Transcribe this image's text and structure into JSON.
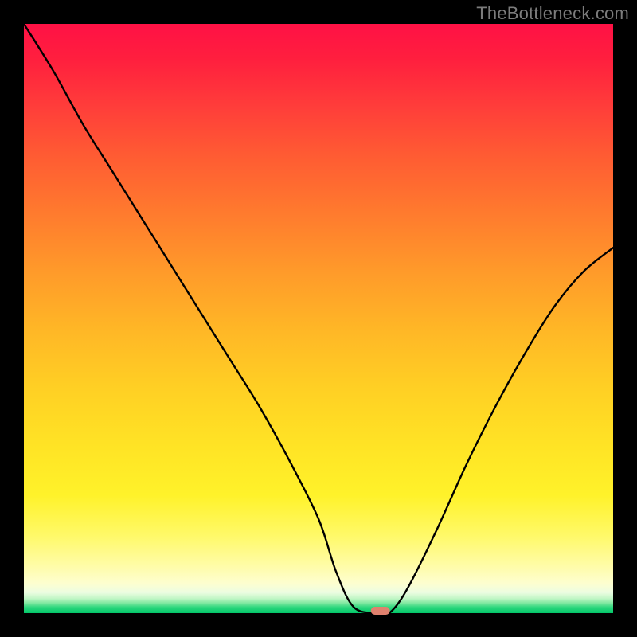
{
  "attribution": "TheBottleneck.com",
  "chart_data": {
    "type": "line",
    "title": "",
    "xlabel": "",
    "ylabel": "",
    "xlim": [
      0,
      100
    ],
    "ylim": [
      0,
      100
    ],
    "legend": false,
    "grid": false,
    "series": [
      {
        "name": "bottleneck-curve",
        "x": [
          0,
          5,
          10,
          15,
          20,
          25,
          30,
          35,
          40,
          45,
          50,
          53,
          56,
          60,
          62,
          65,
          70,
          75,
          80,
          85,
          90,
          95,
          100
        ],
        "values": [
          100,
          92,
          83,
          75,
          67,
          59,
          51,
          43,
          35,
          26,
          16,
          7,
          1,
          0,
          0,
          4,
          14,
          25,
          35,
          44,
          52,
          58,
          62
        ]
      }
    ],
    "annotations": [
      {
        "name": "optimum-marker",
        "x": 60.5,
        "y": 0.4,
        "shape": "pill",
        "color": "#e0816e"
      }
    ],
    "background_gradient": {
      "direction": "vertical",
      "stops": [
        {
          "pos": 0,
          "color": "#ff1145"
        },
        {
          "pos": 0.5,
          "color": "#ffb726"
        },
        {
          "pos": 0.9,
          "color": "#fff96a"
        },
        {
          "pos": 1.0,
          "color": "#02c768"
        }
      ]
    }
  }
}
